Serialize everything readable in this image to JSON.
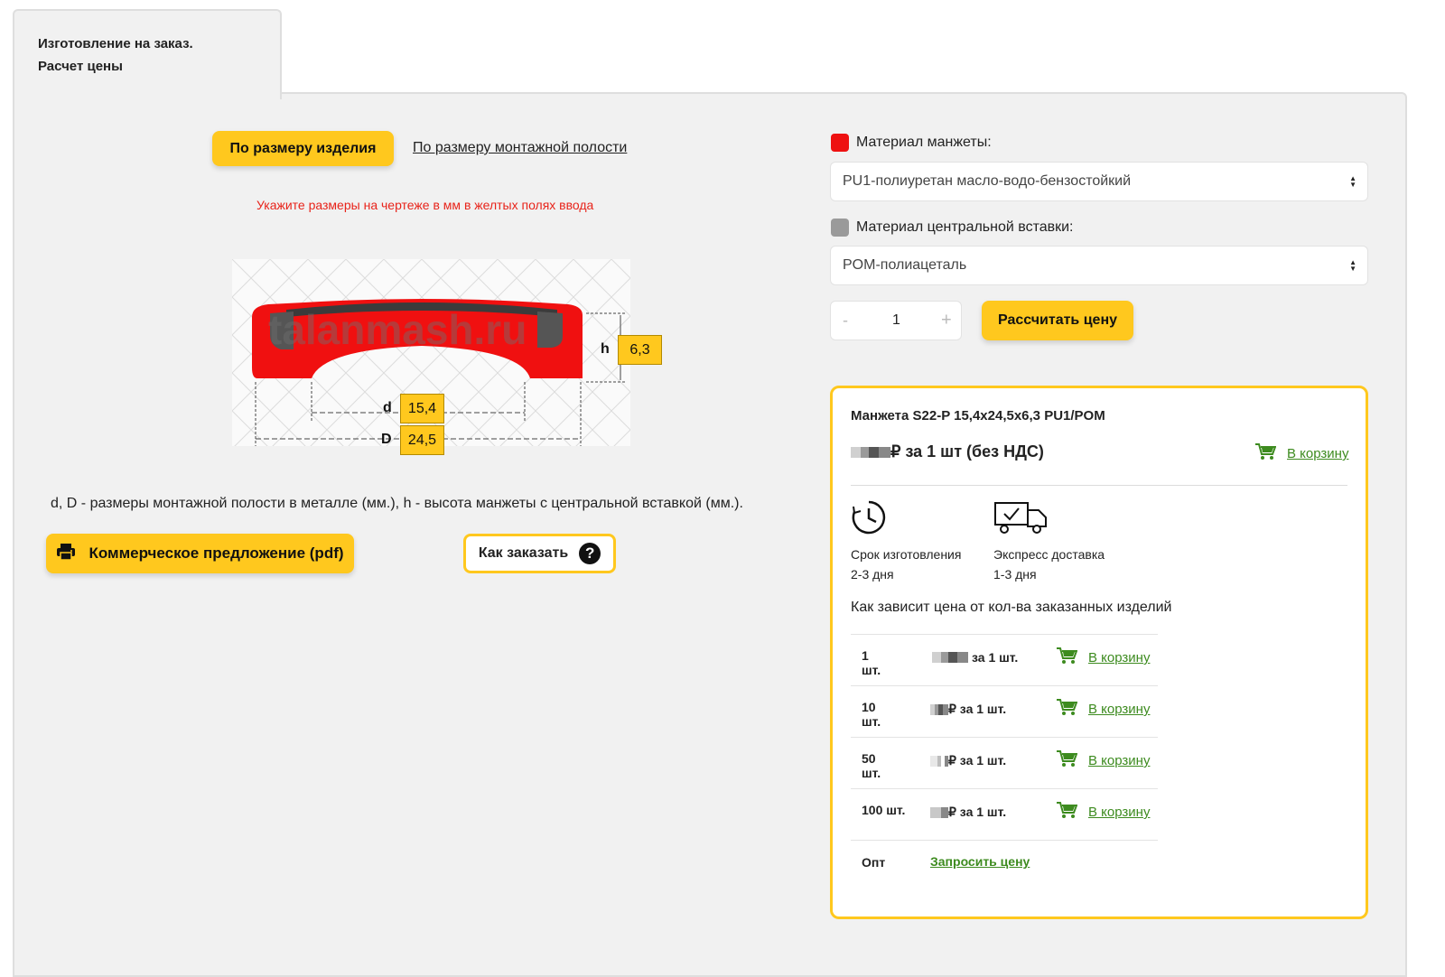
{
  "tab": {
    "title_line1": "Изготовление на заказ.",
    "title_line2": "Расчет цены"
  },
  "mode": {
    "active_label": "По размеру изделия",
    "other_label": "По размеру монтажной полости"
  },
  "hint": "Укажите размеры на чертеже в мм в желтых полях ввода",
  "drawing": {
    "watermark": "talanmash.ru",
    "h_label": "h",
    "h_value": "6,3",
    "d_label": "d",
    "d_value": "15,4",
    "D_label": "D",
    "D_value": "24,5"
  },
  "note": "d, D - размеры монтажной полости в металле (мм.), h - высота манжеты с центральной вставкой (мм.).",
  "buttons": {
    "pdf_label": "Коммерческое предложение (pdf)",
    "how_label": "Как заказать",
    "calc_label": "Рассчитать цену"
  },
  "material_cuff": {
    "label": "Материал манжеты:",
    "color": "#ee1111",
    "value": "PU1-полиуретан масло-водо-бензостойкий"
  },
  "material_insert": {
    "label": "Материал центральной вставки:",
    "color": "#9a9a9a",
    "value": "POM-полиацеталь"
  },
  "stepper": {
    "minus": "-",
    "value": "1",
    "plus": "+"
  },
  "result": {
    "title": "Манжета S22-P 15,4x24,5x6,3 PU1/POM",
    "price_suffix": "₽ за 1 шт (без НДС)",
    "cart_label": "В корзину",
    "lead_time_label": "Срок изготовления",
    "lead_time_value": "2-3 дня",
    "delivery_label": "Экспресс доставка",
    "delivery_value": "1-3 дня",
    "tiers_heading": "Как зависит цена от кол-ва заказанных изделий",
    "tiers": [
      {
        "qty": "1 шт.",
        "per": "за 1 шт.",
        "cart": "В корзину"
      },
      {
        "qty": "10 шт.",
        "per": "₽ за 1 шт.",
        "cart": "В корзину"
      },
      {
        "qty": "50 шт.",
        "per": "₽ за 1 шт.",
        "cart": "В корзину"
      },
      {
        "qty": "100 шт.",
        "per": "₽ за 1 шт.",
        "cart": "В корзину"
      }
    ],
    "wholesale_label": "Опт",
    "wholesale_link": "Запросить цену"
  },
  "colors": {
    "accent": "#ffc81e",
    "cart_green": "#3d8b1f",
    "hint_red": "#e8231a"
  }
}
